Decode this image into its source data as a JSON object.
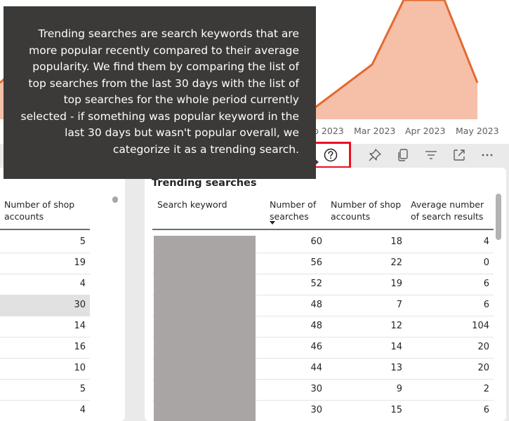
{
  "tooltip": {
    "text": "Trending searches are search keywords that are more popular recently compared to their average popularity. We find them by comparing the list of top searches from the last 30 days with the list of top searches for the whole period currently selected - if something was popular keyword in the last 30 days but wasn't popular overall, we categorize it as a trending search."
  },
  "chart": {
    "x_ticks": [
      "Mar 2023",
      "Apr 2023",
      "May 2023"
    ],
    "partial_tick": "p 2023",
    "colors": {
      "line": "#e3692f",
      "fill": "#f5c0a7"
    }
  },
  "toolbar": {
    "icons": [
      "help-icon",
      "pin-icon",
      "copy-icon",
      "filter-icon",
      "focus-mode-icon",
      "more-options-icon"
    ]
  },
  "left_table": {
    "header": "Number of shop accounts",
    "rows": [
      "5",
      "19",
      "4",
      "30",
      "14",
      "16",
      "10",
      "5",
      "4"
    ],
    "selected_index": 3
  },
  "trending": {
    "title": "Trending searches",
    "columns": [
      "Search keyword",
      "Number of searches",
      "Number of shop accounts",
      "Average number of search results"
    ],
    "sorted_column": "Number of searches",
    "rows": [
      [
        "60",
        "18",
        "4"
      ],
      [
        "56",
        "22",
        "0"
      ],
      [
        "52",
        "19",
        "6"
      ],
      [
        "48",
        "7",
        "6"
      ],
      [
        "48",
        "12",
        "104"
      ],
      [
        "46",
        "14",
        "20"
      ],
      [
        "44",
        "13",
        "20"
      ],
      [
        "30",
        "9",
        "2"
      ],
      [
        "30",
        "15",
        "6"
      ]
    ]
  }
}
